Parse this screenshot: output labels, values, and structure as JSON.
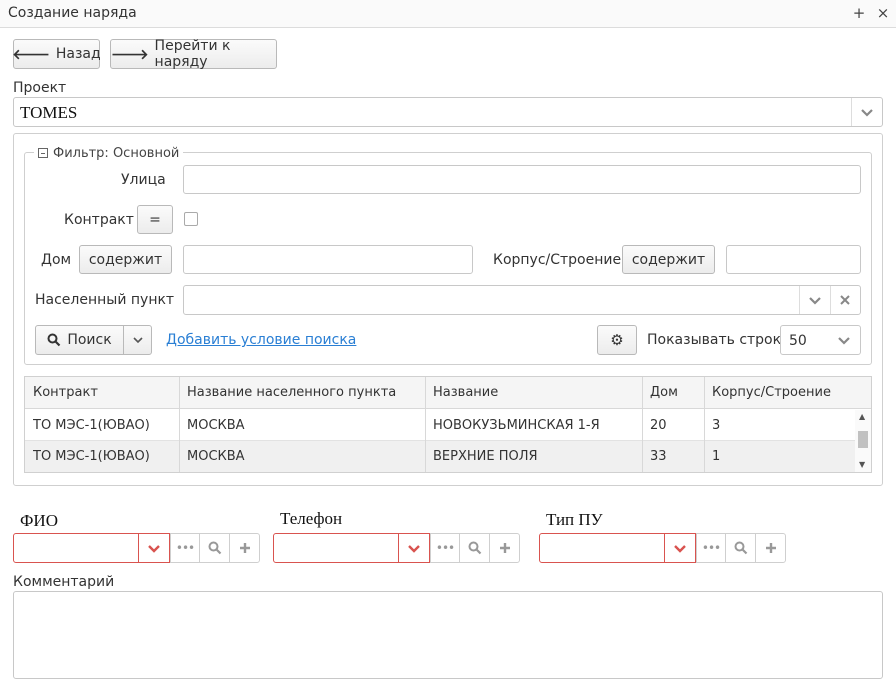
{
  "window": {
    "title": "Создание наряда",
    "pin_glyph": "+",
    "close_glyph": "×"
  },
  "toolbar": {
    "back_label": "Назад",
    "goto_label": "Перейти к наряду"
  },
  "project": {
    "label": "Проект",
    "value": "TOMES"
  },
  "filter": {
    "legend": "Фильтр: Основной",
    "street_label": "Улица",
    "contract_label": "Контракт",
    "contract_op": "=",
    "house_label": "Дом",
    "house_op": "содержит",
    "building_label": "Корпус/Строение",
    "building_op": "содержит",
    "locality_label": "Населенный пункт",
    "search_label": "Поиск",
    "add_condition_label": "Добавить условие поиска",
    "show_rows_label": "Показывать строк",
    "show_rows_value": "50"
  },
  "table": {
    "columns": [
      "Контракт",
      "Название населенного пункта",
      "Название",
      "Дом",
      "Корпус/Строение"
    ],
    "rows": [
      [
        "ТО МЭС-1(ЮВАО)",
        "МОСКВА",
        "НОВОКУЗЬМИНСКАЯ 1-Я",
        "20",
        "3"
      ],
      [
        "ТО МЭС-1(ЮВАО)",
        "МОСКВА",
        "ВЕРХНИЕ ПОЛЯ",
        "33",
        "1"
      ]
    ]
  },
  "lookups": {
    "fio_label": "ФИО",
    "phone_label": "Телефон",
    "meter_type_label": "Тип ПУ"
  },
  "comment": {
    "label": "Комментарий",
    "value": ""
  },
  "colors": {
    "error_border": "#d9534f",
    "link": "#2a7fd4",
    "selected_row": "#f0f0f0"
  }
}
